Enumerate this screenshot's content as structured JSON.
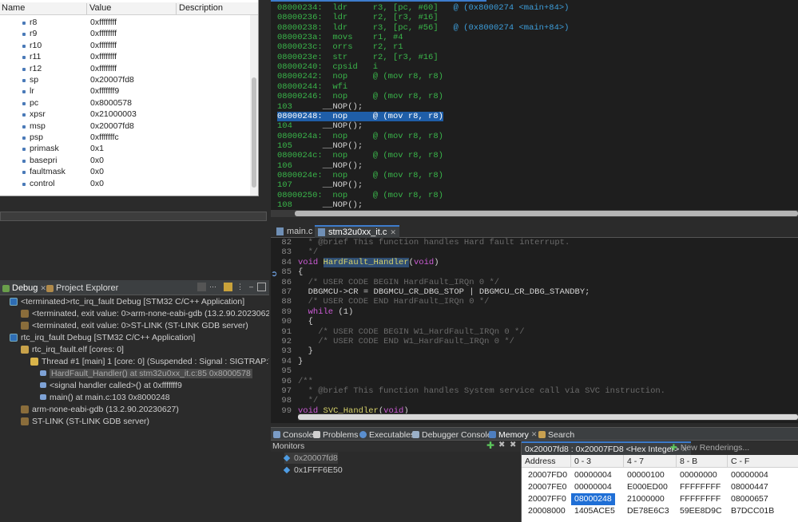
{
  "registers": {
    "columns": [
      "Name",
      "Value",
      "Description"
    ],
    "rows": [
      {
        "name": "r8",
        "value": "0xffffffff"
      },
      {
        "name": "r9",
        "value": "0xffffffff"
      },
      {
        "name": "r10",
        "value": "0xffffffff"
      },
      {
        "name": "r11",
        "value": "0xffffffff"
      },
      {
        "name": "r12",
        "value": "0xffffffff"
      },
      {
        "name": "sp",
        "value": "0x20007fd8"
      },
      {
        "name": "lr",
        "value": "0xfffffff9"
      },
      {
        "name": "pc",
        "value": "0x8000578"
      },
      {
        "name": "xpsr",
        "value": "0x21000003"
      },
      {
        "name": "msp",
        "value": "0x20007fd8"
      },
      {
        "name": "psp",
        "value": "0xfffffffc"
      },
      {
        "name": "primask",
        "value": "0x1"
      },
      {
        "name": "basepri",
        "value": "0x0"
      },
      {
        "name": "faultmask",
        "value": "0x0"
      },
      {
        "name": "control",
        "value": "0x0"
      }
    ]
  },
  "debug_view": {
    "tabs": [
      "Debug",
      "Project Explorer"
    ],
    "tab_close": "✕",
    "tree": [
      {
        "label": "<terminated>rtc_irq_fault Debug [STM32 C/C++ Application]"
      },
      {
        "label": "<terminated, exit value: 0>arm-none-eabi-gdb (13.2.90.20230627)"
      },
      {
        "label": "<terminated, exit value: 0>ST-LINK (ST-LINK GDB server)"
      },
      {
        "label": "rtc_irq_fault Debug [STM32 C/C++ Application]"
      },
      {
        "label": "rtc_irq_fault.elf [cores: 0]"
      },
      {
        "label": "Thread #1 [main] 1 [core: 0] (Suspended : Signal : SIGTRAP:Trace/breakpoint trap)"
      },
      {
        "label": "HardFault_Handler() at stm32u0xx_it.c:85 0x8000578"
      },
      {
        "label": "<signal handler called>() at 0xfffffff9"
      },
      {
        "label": "main() at main.c:103 0x8000248"
      },
      {
        "label": "arm-none-eabi-gdb (13.2.90.20230627)"
      },
      {
        "label": "ST-LINK (ST-LINK GDB server)"
      }
    ]
  },
  "disassembly": [
    {
      "addr": "08000234:",
      "op": "ldr     r3, [pc, #60]",
      "cm": "   @ (0x8000274 <main+84>)"
    },
    {
      "addr": "08000236:",
      "op": "ldr     r2, [r3, #16]",
      "cm": ""
    },
    {
      "addr": "08000238:",
      "op": "ldr     r3, [pc, #56]",
      "cm": "   @ (0x8000274 <main+84>)"
    },
    {
      "addr": "0800023a:",
      "op": "movs    r1, #4",
      "cm": ""
    },
    {
      "addr": "0800023c:",
      "op": "orrs    r2, r1",
      "cm": ""
    },
    {
      "addr": "0800023e:",
      "op": "str     r2, [r3, #16]",
      "cm": ""
    },
    {
      "addr": "08000240:",
      "op": "cpsid   i",
      "cm": ""
    },
    {
      "addr": "08000242:",
      "op": "nop     @ (mov r8, r8)",
      "cm": ""
    },
    {
      "addr": "08000244:",
      "op": "wfi",
      "cm": ""
    },
    {
      "addr": "08000246:",
      "op": "nop     @ (mov r8, r8)",
      "cm": ""
    },
    {
      "src": "103",
      "text": "      __NOP();"
    },
    {
      "addr": "08000248:",
      "op": "nop     @ (mov r8, r8)",
      "cm": "",
      "current": true
    },
    {
      "src": "104",
      "text": "      __NOP();"
    },
    {
      "addr": "0800024a:",
      "op": "nop     @ (mov r8, r8)",
      "cm": ""
    },
    {
      "src": "105",
      "text": "      __NOP();"
    },
    {
      "addr": "0800024c:",
      "op": "nop     @ (mov r8, r8)",
      "cm": ""
    },
    {
      "src": "106",
      "text": "      __NOP();"
    },
    {
      "addr": "0800024e:",
      "op": "nop     @ (mov r8, r8)",
      "cm": ""
    },
    {
      "src": "107",
      "text": "      __NOP();"
    },
    {
      "addr": "08000250:",
      "op": "nop     @ (mov r8, r8)",
      "cm": ""
    },
    {
      "src": "108",
      "text": "      __NOP();"
    }
  ],
  "editor": {
    "tabs": [
      "main.c",
      "stm32u0xx_it.c"
    ],
    "tab_close": "✕",
    "lines": [
      {
        "n": "82",
        "t": "  * @brief This function handles Hard fault interrupt.",
        "k": "cmt"
      },
      {
        "n": "83",
        "t": "  */",
        "k": "cmt"
      },
      {
        "n": "84",
        "t": "void HardFault_Handler(void)",
        "k": "sig"
      },
      {
        "n": "85",
        "t": "{",
        "k": "plain"
      },
      {
        "n": "86",
        "t": "  /* USER CODE BEGIN HardFault_IRQn 0 */",
        "k": "cmt"
      },
      {
        "n": "87",
        "t": "  DBGMCU->CR = DBGMCU_CR_DBG_STOP | DBGMCU_CR_DBG_STANDBY;",
        "k": "plain"
      },
      {
        "n": "88",
        "t": "  /* USER CODE END HardFault_IRQn 0 */",
        "k": "cmt"
      },
      {
        "n": "89",
        "t": "  while (1)",
        "k": "while"
      },
      {
        "n": "90",
        "t": "  {",
        "k": "plain"
      },
      {
        "n": "91",
        "t": "    /* USER CODE BEGIN W1_HardFault_IRQn 0 */",
        "k": "cmt"
      },
      {
        "n": "92",
        "t": "    /* USER CODE END W1_HardFault_IRQn 0 */",
        "k": "cmt"
      },
      {
        "n": "93",
        "t": "  }",
        "k": "plain"
      },
      {
        "n": "94",
        "t": "}",
        "k": "plain"
      },
      {
        "n": "95",
        "t": "",
        "k": "plain"
      },
      {
        "n": "96",
        "t": "/**",
        "k": "cmt"
      },
      {
        "n": "97",
        "t": "  * @brief This function handles System service call via SVC instruction.",
        "k": "cmt"
      },
      {
        "n": "98",
        "t": "  */",
        "k": "cmt"
      },
      {
        "n": "99",
        "t": "void SVC_Handler(void)",
        "k": "sig"
      }
    ]
  },
  "bottom_tabs": [
    "Console",
    "Problems",
    "Executables",
    "Debugger Console",
    "Memory",
    "Search"
  ],
  "memory": {
    "monitors_label": "Monitors",
    "monitors": [
      "0x20007fd8",
      "0x1FFF6E50"
    ],
    "rendering_tab": "0x20007fd8 : 0x20007FD8 <Hex Integer>",
    "rendering_close": "✕",
    "new_renderings": "New Renderings...",
    "columns": [
      "Address",
      "0 - 3",
      "4 - 7",
      "8 - B",
      "C - F"
    ],
    "rows": [
      [
        "20007FD0",
        "00000004",
        "00000100",
        "00000000",
        "00000004"
      ],
      [
        "20007FE0",
        "00000004",
        "E000ED00",
        "FFFFFFFF",
        "08000447"
      ],
      [
        "20007FF0",
        "08000248",
        "21000000",
        "FFFFFFFF",
        "08000657"
      ],
      [
        "20008000",
        "1405ACE5",
        "DE78E6C3",
        "59EE8D9C",
        "B7DCC01B"
      ]
    ]
  }
}
